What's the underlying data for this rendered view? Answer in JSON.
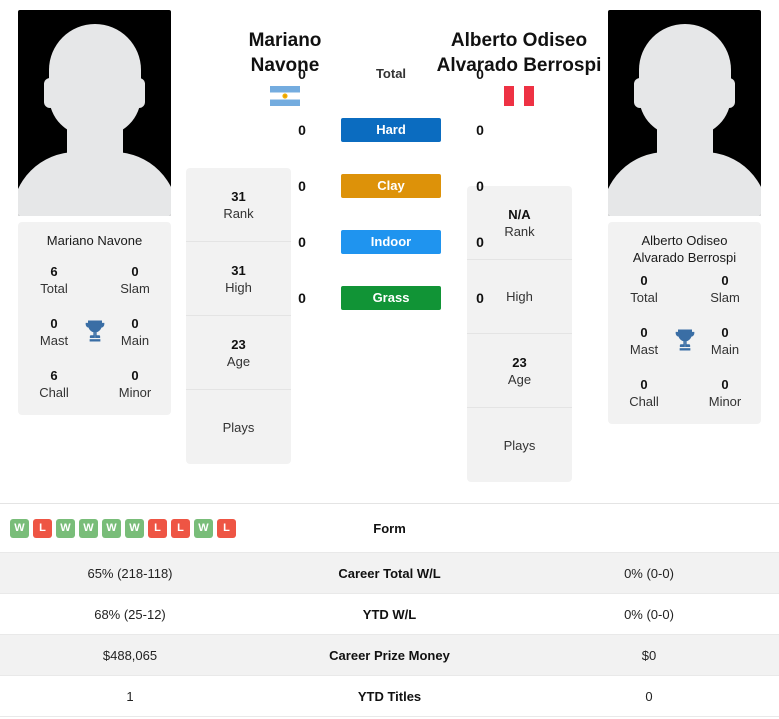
{
  "players": {
    "left": {
      "name_line1": "Mariano",
      "name_line2": "Navone",
      "card_name": "Mariano Navone",
      "flag_country": "Argentina",
      "flag_icon": "argentina-flag-icon",
      "titles": {
        "total_value": "6",
        "total_label": "Total",
        "slam_value": "0",
        "slam_label": "Slam",
        "mast_value": "0",
        "mast_label": "Mast",
        "main_value": "0",
        "main_label": "Main",
        "chall_value": "6",
        "chall_label": "Chall",
        "minor_value": "0",
        "minor_label": "Minor"
      },
      "ranks": [
        {
          "value": "31",
          "label": "Rank"
        },
        {
          "value": "31",
          "label": "High"
        },
        {
          "value": "23",
          "label": "Age"
        },
        {
          "value": "",
          "label": "Plays"
        }
      ]
    },
    "right": {
      "name_line1": "Alberto Odiseo",
      "name_line2": "Alvarado Berrospi",
      "card_name_line1": "Alberto Odiseo",
      "card_name_line2": "Alvarado Berrospi",
      "flag_country": "Peru",
      "flag_icon": "peru-flag-icon",
      "titles": {
        "total_value": "0",
        "total_label": "Total",
        "slam_value": "0",
        "slam_label": "Slam",
        "mast_value": "0",
        "mast_label": "Mast",
        "main_value": "0",
        "main_label": "Main",
        "chall_value": "0",
        "chall_label": "Chall",
        "minor_value": "0",
        "minor_label": "Minor"
      },
      "ranks": [
        {
          "value": "N/A",
          "label": "Rank"
        },
        {
          "value": "",
          "label": "High"
        },
        {
          "value": "23",
          "label": "Age"
        },
        {
          "value": "",
          "label": "Plays"
        }
      ]
    }
  },
  "h2h_surfaces": [
    {
      "label": "Total",
      "left": "0",
      "right": "0",
      "color": "transparent"
    },
    {
      "label": "Hard",
      "left": "0",
      "right": "0",
      "color": "#0b6cc0"
    },
    {
      "label": "Clay",
      "left": "0",
      "right": "0",
      "color": "#dd9209"
    },
    {
      "label": "Indoor",
      "left": "0",
      "right": "0",
      "color": "#1f94ef"
    },
    {
      "label": "Grass",
      "left": "0",
      "right": "0",
      "color": "#119436"
    }
  ],
  "form": {
    "label": "Form",
    "left_results": [
      "W",
      "L",
      "W",
      "W",
      "W",
      "W",
      "L",
      "L",
      "W",
      "L"
    ],
    "right_results": []
  },
  "stats_rows": [
    {
      "label": "Career Total W/L",
      "left": "65% (218-118)",
      "right": "0% (0-0)",
      "shaded": true
    },
    {
      "label": "YTD W/L",
      "left": "68% (25-12)",
      "right": "0% (0-0)",
      "shaded": false
    },
    {
      "label": "Career Prize Money",
      "left": "$488,065",
      "right": "$0",
      "shaded": true
    },
    {
      "label": "YTD Titles",
      "left": "1",
      "right": "0",
      "shaded": false
    }
  ],
  "colors": {
    "hard": "#0b6cc0",
    "clay": "#dd9209",
    "indoor": "#1f94ef",
    "grass": "#119436",
    "win": "#79bd79",
    "loss": "#ee5544",
    "trophy": "#3a6ea5",
    "card_bg": "#f2f2f2"
  }
}
